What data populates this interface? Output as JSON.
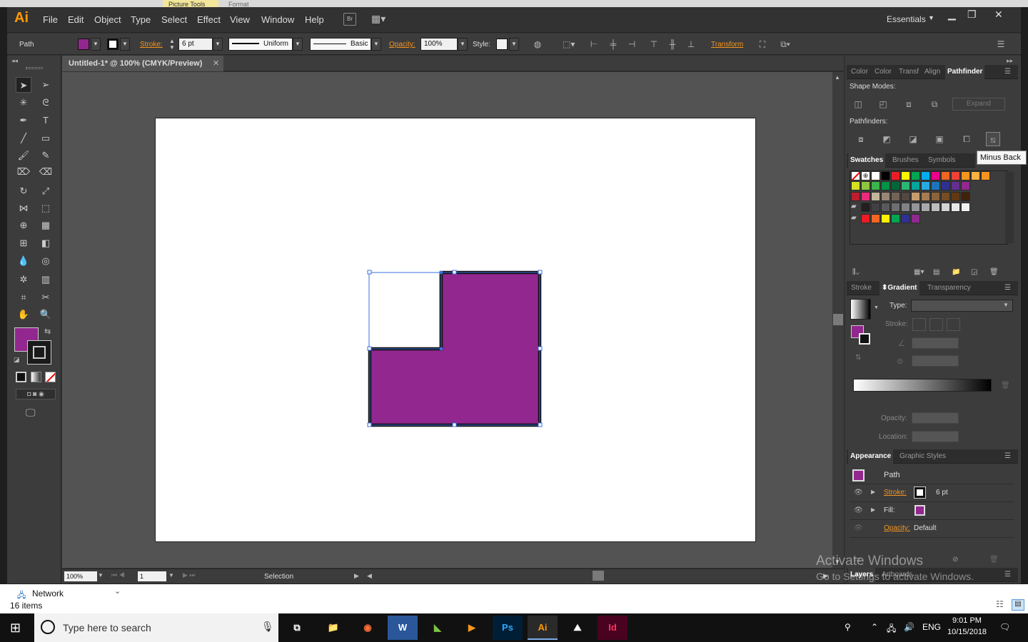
{
  "background_window": {
    "ribbon_tab": "Picture Tools",
    "ribbon_tab_2": "Format",
    "nav_item": "Network",
    "items_count": "16 items"
  },
  "menubar": {
    "logo": "Ai",
    "items": [
      "File",
      "Edit",
      "Object",
      "Type",
      "Select",
      "Effect",
      "View",
      "Window",
      "Help"
    ],
    "bridge_label": "Br",
    "workspace": "Essentials"
  },
  "controlbar": {
    "selection_type": "Path",
    "stroke_label": "Stroke:",
    "stroke_value": "6 pt",
    "profile": "Uniform",
    "brush": "Basic",
    "opacity_label": "Opacity:",
    "opacity_value": "100%",
    "style_label": "Style:",
    "transform_label": "Transform",
    "fill_color": "#92278f"
  },
  "document": {
    "tab_title": "Untitled-1* @ 100% (CMYK/Preview)",
    "zoom": "100%",
    "page": "1",
    "status": "Selection",
    "shape_fill": "#92278f",
    "shape_stroke": "#111111"
  },
  "panels": {
    "pathfinder_tabs": [
      "Color",
      "Color",
      "Transf",
      "Align",
      "Pathfinder"
    ],
    "shape_modes_label": "Shape Modes:",
    "pathfinders_label": "Pathfinders:",
    "expand_label": "Expand",
    "tooltip": "Minus Back",
    "swatch_tabs": [
      "Swatches",
      "Brushes",
      "Symbols"
    ],
    "gradient_tabs": [
      "Stroke",
      "Gradient",
      "Transparency"
    ],
    "type_label": "Type:",
    "stroke_label": "Stroke:",
    "opacity_label": "Opacity:",
    "location_label": "Location:",
    "appearance_tabs": [
      "Appearance",
      "Graphic Styles"
    ],
    "appearance_title": "Path",
    "app_stroke_label": "Stroke:",
    "app_stroke_value": "6 pt",
    "app_fill_label": "Fill:",
    "app_opacity_label": "Opacity:",
    "app_opacity_value": "Default",
    "layers_tabs": [
      "Layers",
      "Artboards"
    ]
  },
  "watermark": {
    "line1": "Activate Windows",
    "line2": "Go to Settings to activate Windows."
  },
  "taskbar": {
    "search_placeholder": "Type here to search",
    "apps": [
      "Ps",
      "Ai",
      "Id"
    ],
    "language": "ENG",
    "time": "9:01 PM",
    "date": "10/15/2018"
  },
  "swatches": [
    "#ffffff",
    "#000000",
    "#ed1c24",
    "#fff200",
    "#00a651",
    "#00aeef",
    "#ec008c",
    "#f26522",
    "#ef4136",
    "#f7941d",
    "#fbb040",
    "#f7931e",
    "#d7df23",
    "#8dc63f",
    "#39b54a",
    "#009444",
    "#006838",
    "#2bb673",
    "#00a79d",
    "#27aae1",
    "#1c75bc",
    "#2e3192",
    "#662d91",
    "#92278f",
    "#be1e2d",
    "#ee2a7b",
    "#c2b59b",
    "#998675",
    "#736357",
    "#534741",
    "#c69c6d",
    "#a67c52",
    "#8c6239",
    "#754c24",
    "#603813",
    "#42210b",
    "#231f20",
    "#414042",
    "#58595b",
    "#6d6e71",
    "#808285",
    "#939598",
    "#a7a9ac",
    "#bcbec0",
    "#d1d3d4",
    "#e6e7e8",
    "#f1f2f2",
    "#ed1c24",
    "#f26522",
    "#fff200",
    "#00a651",
    "#2e3192",
    "#92278f"
  ]
}
